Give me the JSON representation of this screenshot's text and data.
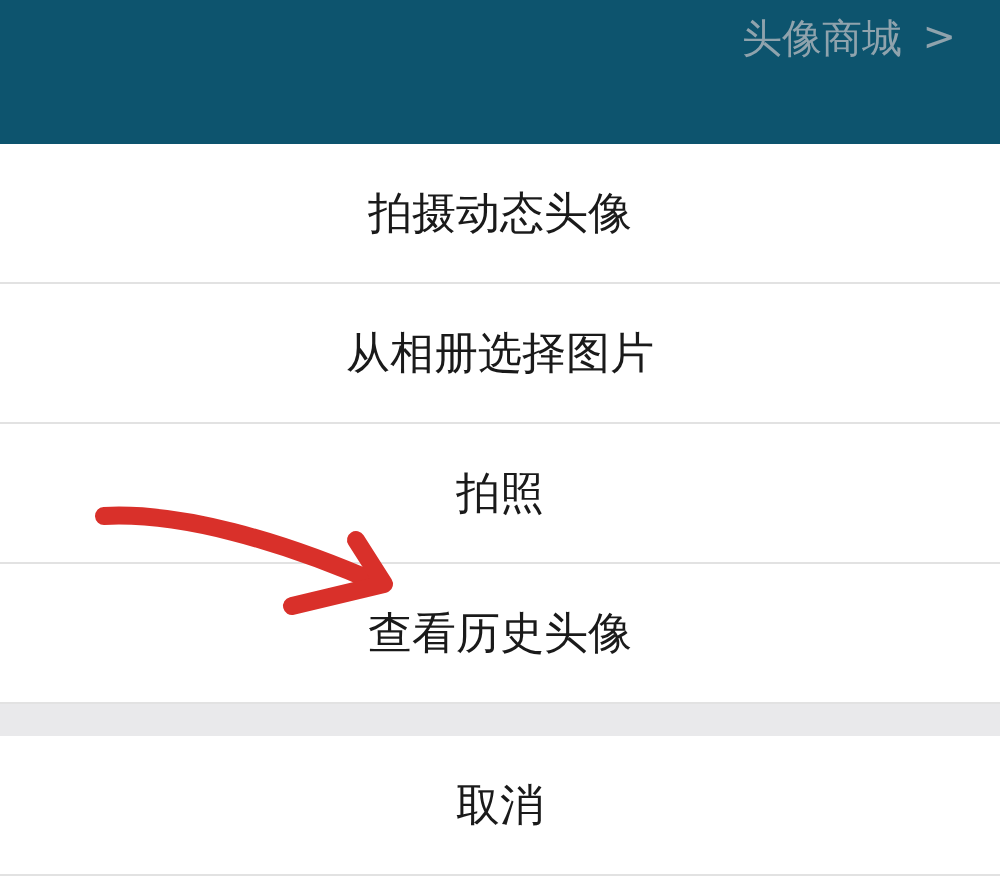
{
  "header": {
    "link": "头像商城",
    "chevron": ">"
  },
  "actions": [
    {
      "label": "拍摄动态头像"
    },
    {
      "label": "从相册选择图片"
    },
    {
      "label": "拍照"
    },
    {
      "label": "查看历史头像"
    }
  ],
  "cancel": {
    "label": "取消"
  }
}
